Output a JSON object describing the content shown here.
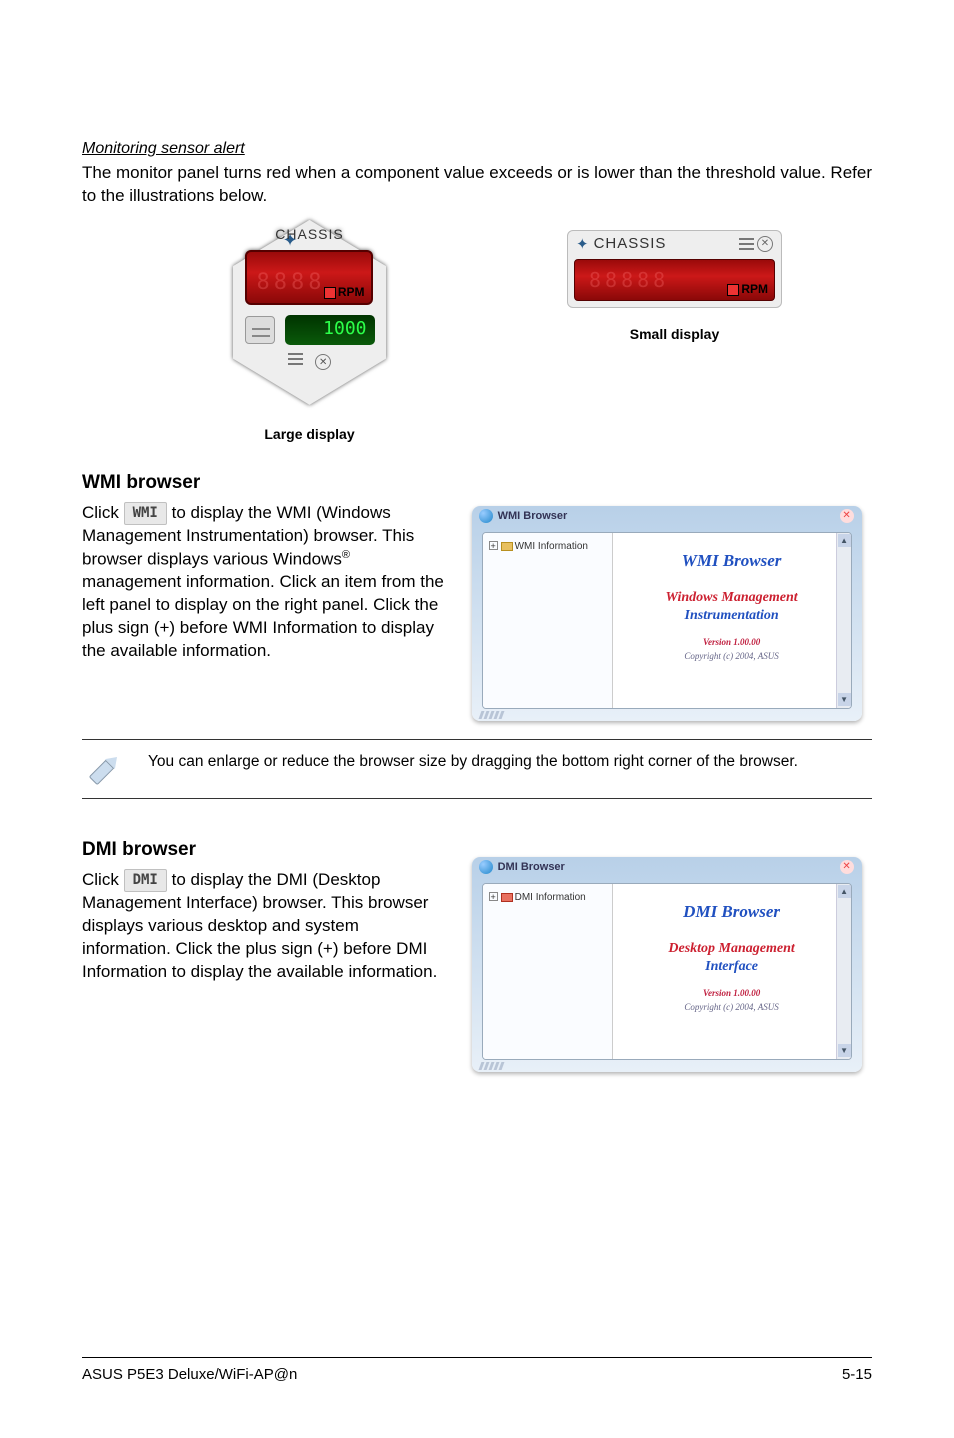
{
  "monitoring": {
    "heading": "Monitoring sensor alert",
    "para": "The monitor panel turns red when a component value exceeds or is lower than the threshold value. Refer to the illustrations below."
  },
  "panels": {
    "chassis_label": "CHASSIS",
    "rpm_label": "RPM",
    "large_green": "1000",
    "large_caption": "Large display",
    "small_caption": "Small display"
  },
  "wmi": {
    "heading": "WMI browser",
    "btn": "WMI",
    "para_pre": "Click ",
    "para_post": " to display the WMI (Windows Management Instrumentation) browser. This browser displays various Windows",
    "para_after_sup": " management information. Click an item from the left panel to display on the right panel. Click the plus sign (+) before WMI Information to display the available information.",
    "win_title": "WMI Browser",
    "tree_label": "WMI Information",
    "content_title": "WMI Browser",
    "content_sub1": "Windows Management",
    "content_sub2": "Instrumentation",
    "version": "Version 1.00.00",
    "copyright": "Copyright (c) 2004,  ASUS"
  },
  "note": {
    "text": "You can enlarge or reduce the browser size by dragging the bottom right corner of the browser."
  },
  "dmi": {
    "heading": "DMI browser",
    "btn": "DMI",
    "para_pre": "Click ",
    "para_post": " to display the DMI (Desktop Management Interface) browser. This browser displays various desktop and system information. Click the plus sign (+) before DMI Information to display the available information.",
    "win_title": "DMI Browser",
    "tree_label": "DMI Information",
    "content_title": "DMI Browser",
    "content_sub1": "Desktop Management",
    "content_sub2": "Interface",
    "version": "Version 1.00.00",
    "copyright": "Copyright (c) 2004,  ASUS"
  },
  "footer": {
    "left": "ASUS P5E3 Deluxe/WiFi-AP@n",
    "right": "5-15"
  }
}
